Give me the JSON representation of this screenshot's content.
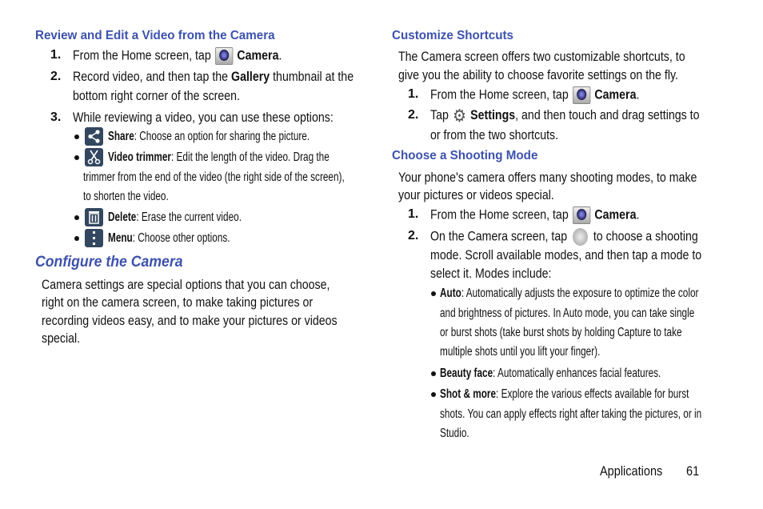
{
  "left": {
    "heading": "Review and Edit a Video from the Camera",
    "steps": [
      {
        "num": "1.",
        "a": "From the Home screen, tap",
        "b": "Camera",
        "c": "."
      },
      {
        "num": "2.",
        "a": "Record video, and then tap the",
        "b": "Gallery",
        "c": "thumbnail at the",
        "d": "bottom right corner of the screen."
      },
      {
        "num": "3.",
        "a": "While reviewing a video, you can use these options:"
      }
    ],
    "options": [
      {
        "icon": "share-icon",
        "name": "Share",
        "desc": ": Choose an option for sharing the picture."
      },
      {
        "icon": "scissors-icon",
        "name": "Video trimmer",
        "desc": ": Edit the length of the video. Drag the",
        "l2": "trimmer from the end of the video (the right side of the screen),",
        "l3": "to shorten the video."
      },
      {
        "icon": "trash-icon",
        "name": "Delete",
        "desc": ": Erase the current video."
      },
      {
        "icon": "menu-icon",
        "name": "Menu",
        "desc": ": Choose other options."
      }
    ],
    "section": "Configure the Camera",
    "para": [
      "Camera settings are special options that you can choose,",
      "right on the camera screen, to make taking pictures or",
      "recording videos easy, and to make your pictures or videos",
      "special."
    ]
  },
  "right": {
    "heading1": "Customize Shortcuts",
    "para1": [
      "The Camera screen offers two customizable shortcuts, to",
      "give you the ability to choose favorite settings on the fly."
    ],
    "steps1": [
      {
        "num": "1.",
        "a": "From the Home screen, tap",
        "b": "Camera",
        "c": "."
      },
      {
        "num": "2.",
        "a": "Tap",
        "b": "Settings",
        "c": ", and then touch and drag settings to",
        "d": "or from the two shortcuts."
      }
    ],
    "heading2": "Choose a Shooting Mode",
    "para2": [
      "Your phone's camera offers many shooting modes, to make",
      "your pictures or videos special."
    ],
    "steps2": [
      {
        "num": "1.",
        "a": "From the Home screen, tap",
        "b": "Camera",
        "c": "."
      },
      {
        "num": "2.",
        "a": "On the Camera screen, tap",
        "c": "to choose a shooting",
        "d": "mode. Scroll available modes, and then tap a mode to",
        "e": "select it. Modes include:"
      }
    ],
    "modes": [
      {
        "name": "Auto",
        "desc": ": Automatically adjusts the exposure to optimize the color",
        "l2": "and brightness of pictures. In Auto mode, you can take single",
        "l3": "or burst shots (take burst shots by holding Capture to take",
        "l4": "multiple shots until you lift your finger)."
      },
      {
        "name": "Beauty face",
        "desc": ": Automatically enhances facial features."
      },
      {
        "name": "Shot & more",
        "desc": ": Explore the various effects available for burst",
        "l2": "shots. You can apply effects right after taking the pictures, or in",
        "l3": "Studio."
      }
    ]
  },
  "footer": {
    "section": "Applications",
    "page": "61"
  },
  "colors": {
    "heading": "#3d52ad",
    "icon_tile": "#33475f"
  }
}
